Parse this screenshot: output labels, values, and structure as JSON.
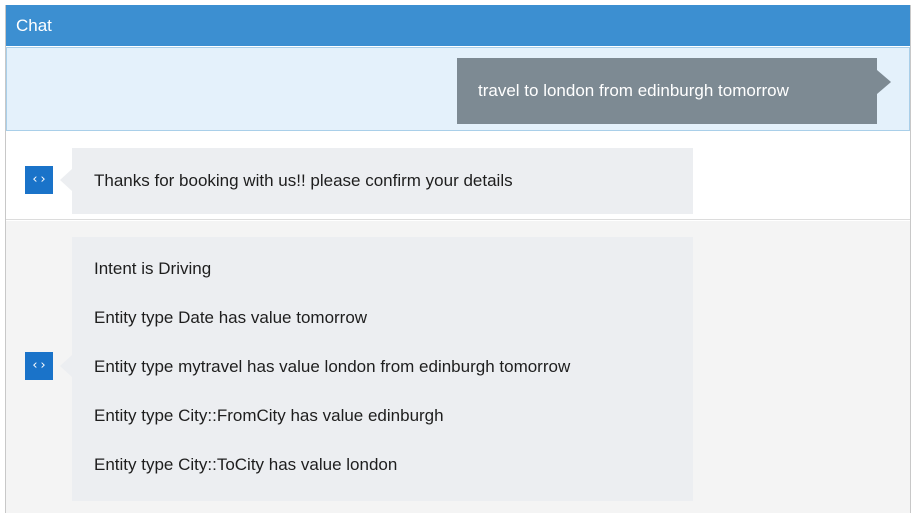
{
  "header": {
    "title": "Chat"
  },
  "user_message": {
    "text": "travel to london from edinburgh tomorrow"
  },
  "bot_messages": [
    {
      "avatar_icon": "code-brackets-icon",
      "avatar_glyph": "‹›",
      "lines": [
        "Thanks for booking with us!! please confirm your details"
      ]
    },
    {
      "avatar_icon": "code-brackets-icon",
      "avatar_glyph": "‹›",
      "lines": [
        "Intent is Driving",
        "Entity type Date has value tomorrow",
        "Entity type mytravel has value london from edinburgh tomorrow",
        "Entity type City::FromCity has value edinburgh",
        "Entity type City::ToCity has value london"
      ]
    }
  ],
  "colors": {
    "header_bg": "#3c8fd1",
    "user_row_bg": "#e4f1fb",
    "user_bubble_bg": "#7d8a93",
    "bot_avatar_bg": "#1a73c9",
    "bot_bubble_bg": "#eceef1"
  }
}
